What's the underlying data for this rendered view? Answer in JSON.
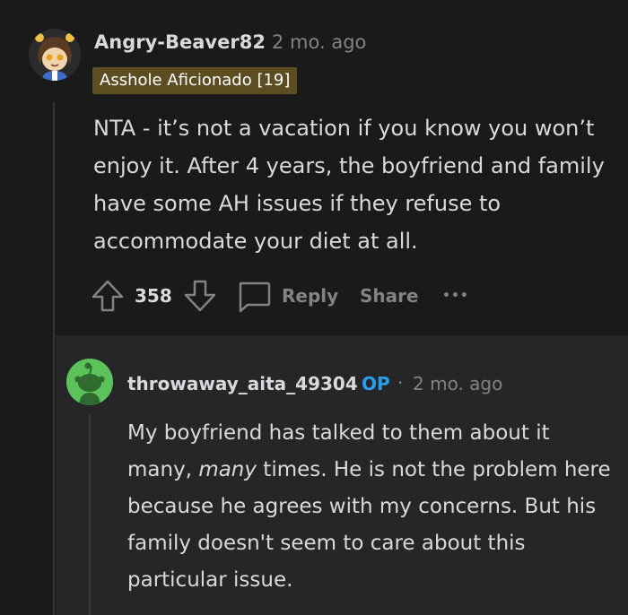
{
  "comment": {
    "username": "Angry-Beaver82",
    "separator": "·",
    "time": "2 mo. ago",
    "flair": "Asshole Aficionado [19]",
    "body": "NTA - it’s not a vacation if you know you won’t enjoy it. After 4 years, the boyfriend and family have some AH issues if they refuse to accommodate your diet at all.",
    "votes": "358",
    "reply_label": "Reply",
    "share_label": "Share",
    "more_label": "•••"
  },
  "reply": {
    "username": "throwaway_aita_49304",
    "op_badge": "OP",
    "separator": "·",
    "time": "2 mo. ago",
    "body_part1": "My boyfriend has talked to them about it many, ",
    "body_emphasis": "many",
    "body_part2": " times. He is not the problem here because he agrees with my concerns. But his family doesn't seem to care about this particular issue."
  },
  "colors": {
    "background": "#1a1a1b",
    "reply_background": "#262628",
    "flair": "#5d4e22",
    "op": "#24a0ed",
    "snoo_avatar": "#5bc35a"
  },
  "icons": [
    "upvote-icon",
    "downvote-icon",
    "comment-icon",
    "more-icon"
  ]
}
